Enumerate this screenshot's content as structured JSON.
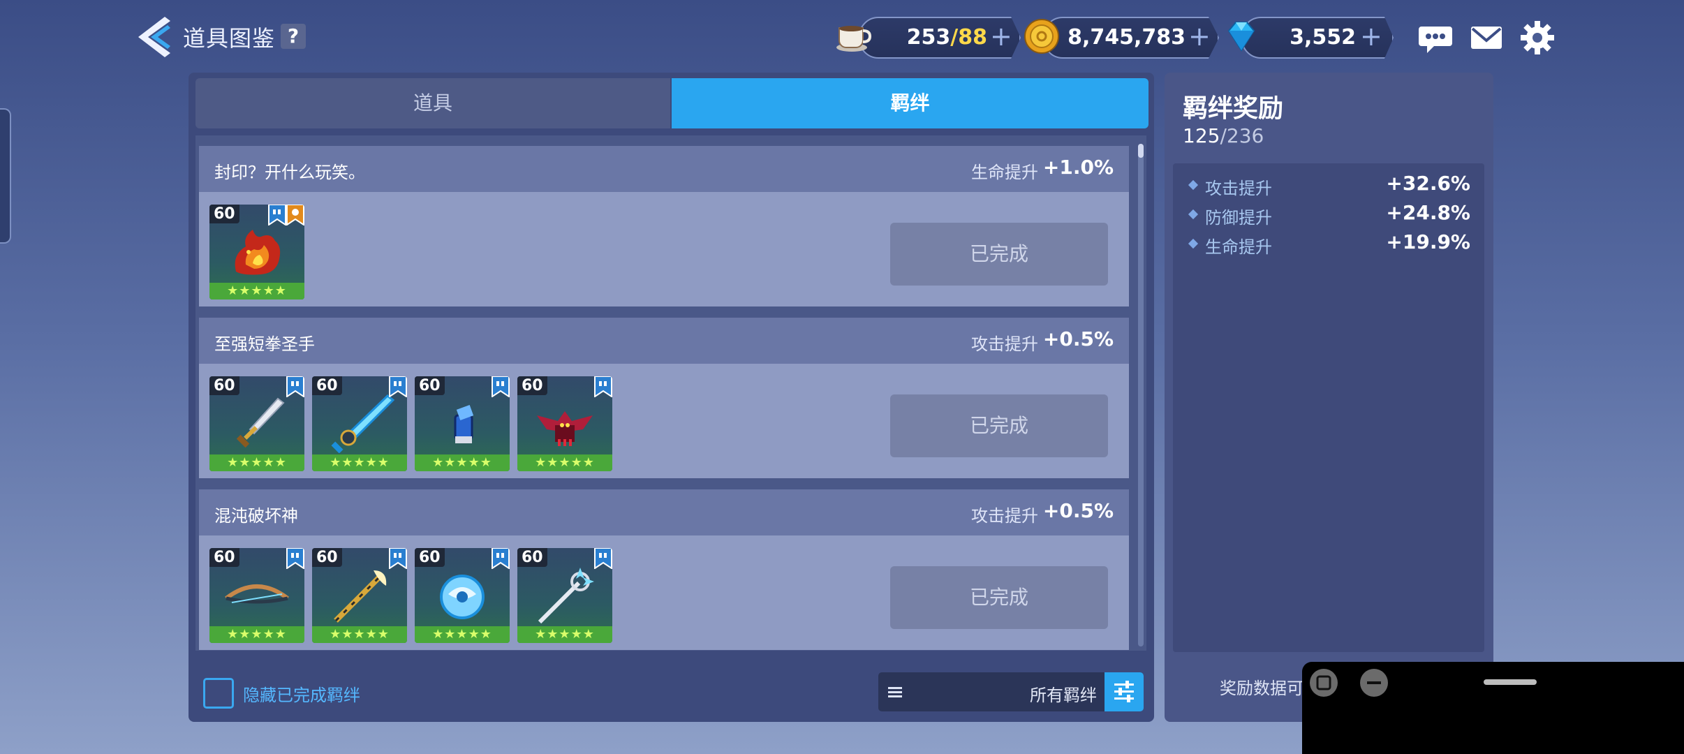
{
  "header": {
    "title": "道具图鉴",
    "help": "?"
  },
  "resources": {
    "stamina_current": "253",
    "stamina_max": "88",
    "coins": "8,745,783",
    "gems": "3,552",
    "plus": "+"
  },
  "tabs": {
    "items": "道具",
    "bonds": "羁绊",
    "active": "bonds"
  },
  "bonds": [
    {
      "title": "封印？开什么玩笑。",
      "stat": "生命提升",
      "value": "+1.0%",
      "status": "已完成",
      "items": [
        {
          "level": "60",
          "stars": "★★★★★",
          "icon": "fire-dragon-icon",
          "badges": [
            "blue-bookmark-icon",
            "orange-bookmark-icon"
          ]
        }
      ]
    },
    {
      "title": "至强短拳圣手",
      "stat": "攻击提升",
      "value": "+0.5%",
      "status": "已完成",
      "items": [
        {
          "level": "60",
          "stars": "★★★★★",
          "icon": "golden-sword-icon"
        },
        {
          "level": "60",
          "stars": "★★★★★",
          "icon": "ice-greatsword-icon"
        },
        {
          "level": "60",
          "stars": "★★★★★",
          "icon": "blue-gauntlet-icon"
        },
        {
          "level": "60",
          "stars": "★★★★★",
          "icon": "bat-demon-icon"
        }
      ]
    },
    {
      "title": "混沌破坏神",
      "stat": "攻击提升",
      "value": "+0.5%",
      "status": "已完成",
      "items": [
        {
          "level": "60",
          "stars": "★★★★★",
          "icon": "dark-bow-icon"
        },
        {
          "level": "60",
          "stars": "★★★★★",
          "icon": "golden-staff-icon"
        },
        {
          "level": "60",
          "stars": "★★★★★",
          "icon": "frost-orb-icon"
        },
        {
          "level": "60",
          "stars": "★★★★★",
          "icon": "crystal-spear-icon"
        }
      ]
    }
  ],
  "footer": {
    "hide_completed": "隐藏已完成羁绊",
    "filter_label": "所有羁绊"
  },
  "rewards": {
    "title": "羁绊奖励",
    "count_current": "125",
    "count_total": "/236",
    "stats": [
      {
        "name": "攻击提升",
        "value": "+32.6%"
      },
      {
        "name": "防御提升",
        "value": "+24.8%"
      },
      {
        "name": "生命提升",
        "value": "+19.9%"
      }
    ],
    "footer_text": "奖励数据可"
  }
}
